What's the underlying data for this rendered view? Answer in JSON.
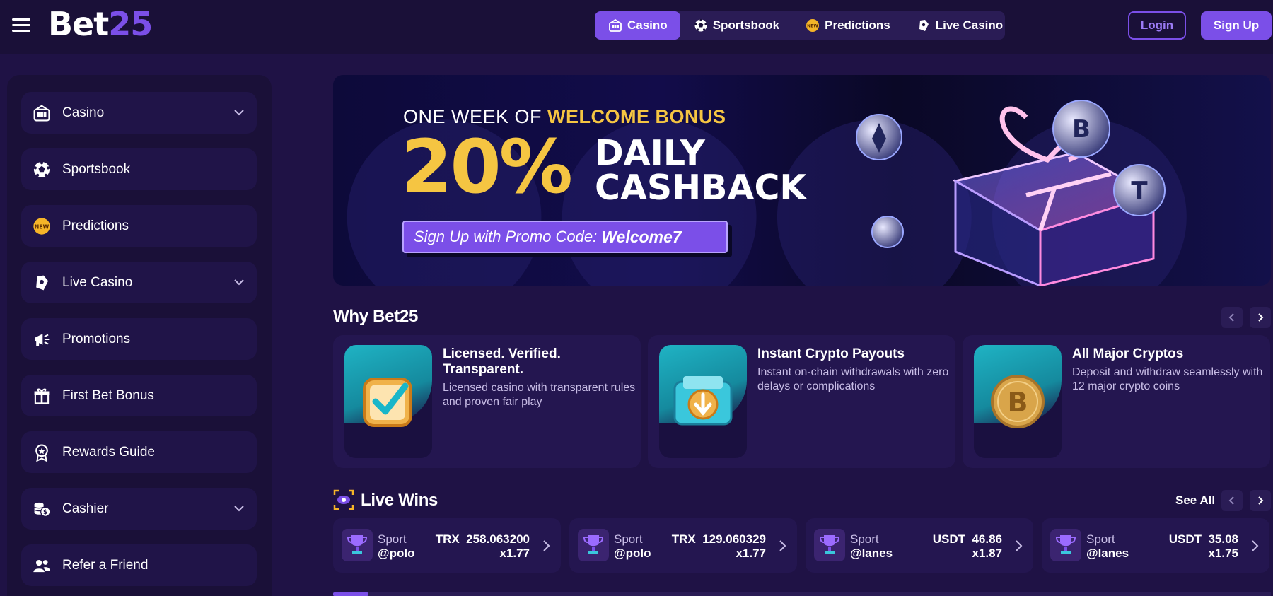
{
  "brand": {
    "name_part1": "Bet",
    "name_part2": "25",
    "accent": "#7b4fe8",
    "highlight": "#f5c542"
  },
  "topnav": {
    "items": [
      {
        "label": "Casino",
        "icon": "casino-icon",
        "active": true
      },
      {
        "label": "Sportsbook",
        "icon": "soccer-ball-icon",
        "active": false
      },
      {
        "label": "Predictions",
        "icon": "new-badge-icon",
        "active": false
      },
      {
        "label": "Live Casino",
        "icon": "live-casino-icon",
        "active": false
      }
    ],
    "login_label": "Login",
    "signup_label": "Sign Up"
  },
  "sidebar": {
    "items": [
      {
        "label": "Casino",
        "icon": "casino-icon",
        "expandable": true
      },
      {
        "label": "Sportsbook",
        "icon": "soccer-ball-icon",
        "expandable": false
      },
      {
        "label": "Predictions",
        "icon": "new-badge-icon",
        "expandable": false
      },
      {
        "label": "Live Casino",
        "icon": "live-casino-icon",
        "expandable": true
      },
      {
        "label": "Promotions",
        "icon": "megaphone-icon",
        "expandable": false
      },
      {
        "label": "First Bet Bonus",
        "icon": "gift-icon",
        "expandable": false
      },
      {
        "label": "Rewards Guide",
        "icon": "award-icon",
        "expandable": false
      },
      {
        "label": "Cashier",
        "icon": "coins-icon",
        "expandable": true
      },
      {
        "label": "Refer a Friend",
        "icon": "users-icon",
        "expandable": false
      }
    ]
  },
  "banner": {
    "line1_prefix": "ONE WEEK OF",
    "line1_highlight": "WELCOME BONUS",
    "percent": "20%",
    "line2": "DAILY",
    "line3": "CASHBACK",
    "promo_prefix": "Sign Up with Promo Code:",
    "promo_code": "Welcome7"
  },
  "why": {
    "title": "Why Bet25",
    "cards": [
      {
        "title": "Licensed. Verified. Transparent.",
        "desc": "Licensed casino with transparent rules and proven fair play",
        "icon": "checkbox-icon"
      },
      {
        "title": "Instant Crypto Payouts",
        "desc": "Instant on-chain withdrawals with zero delays or complications",
        "icon": "wallet-icon"
      },
      {
        "title": "All Major Cryptos",
        "desc": "Deposit and withdraw seamlessly with 12 major crypto coins",
        "icon": "bitcoin-icon"
      }
    ]
  },
  "live_wins": {
    "title": "Live Wins",
    "see_all": "See All",
    "wins": [
      {
        "type": "Sport",
        "user": "@polo",
        "currency": "TRX",
        "amount": "258.063200",
        "multiplier": "x1.77"
      },
      {
        "type": "Sport",
        "user": "@polo",
        "currency": "TRX",
        "amount": "129.060329",
        "multiplier": "x1.77"
      },
      {
        "type": "Sport",
        "user": "@lanes",
        "currency": "USDT",
        "amount": "46.86",
        "multiplier": "x1.87"
      },
      {
        "type": "Sport",
        "user": "@lanes",
        "currency": "USDT",
        "amount": "35.08",
        "multiplier": "x1.75"
      }
    ]
  }
}
